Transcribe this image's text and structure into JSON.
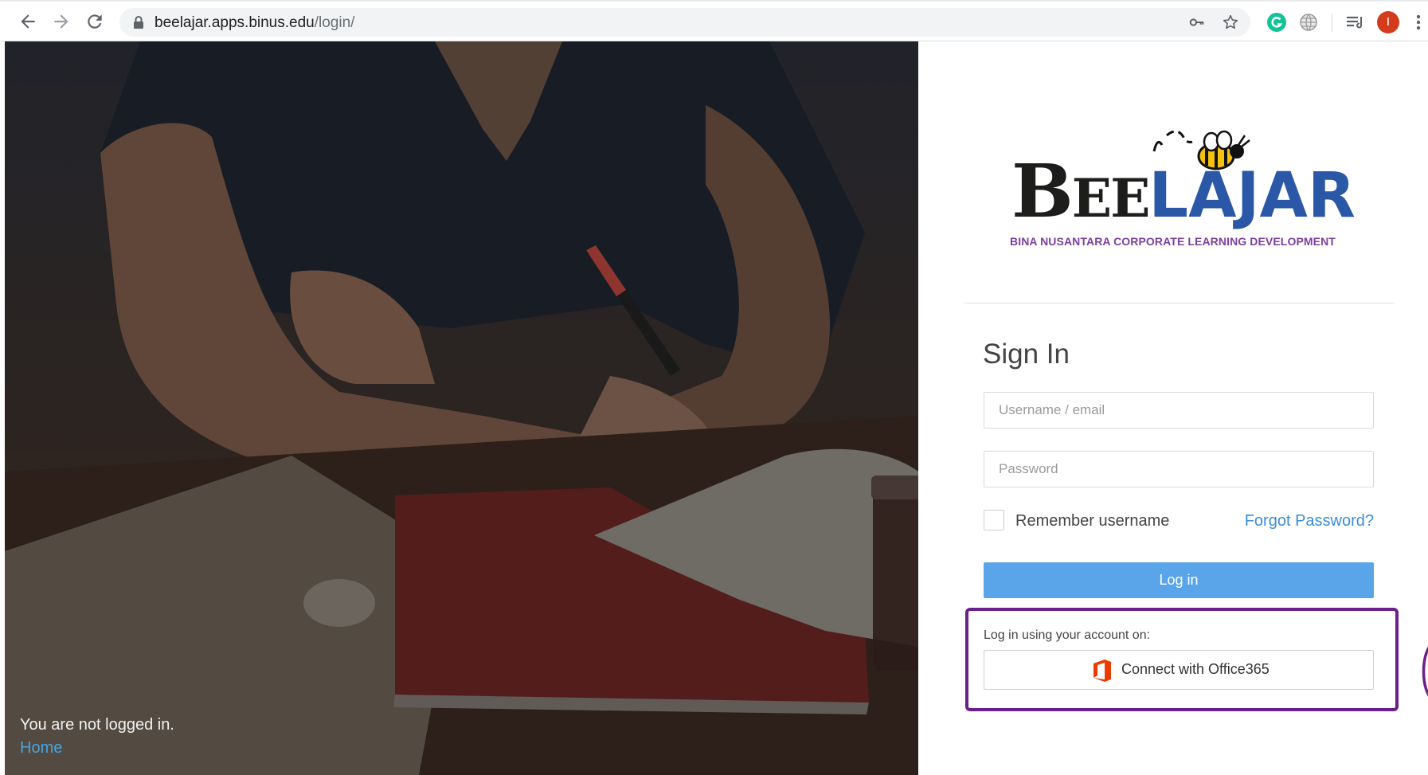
{
  "browser": {
    "url_host": "beelajar.apps.binus.edu",
    "url_path": "/login/",
    "profile_initial": "I",
    "icons": [
      "back-arrow-icon",
      "forward-arrow-icon",
      "reload-icon",
      "lock-icon",
      "key-icon",
      "star-icon",
      "grammarly-icon",
      "globe-icon",
      "reading-list-icon",
      "profile-avatar",
      "more-menu-icon"
    ]
  },
  "hero": {
    "status_text": "You are not logged in.",
    "home_link": "Home"
  },
  "logo": {
    "wordmark_black_big": "B",
    "wordmark_black_small": "EE",
    "wordmark_blue": "LAJAR",
    "tagline": "BINA NUSANTARA CORPORATE LEARNING DEVELOPMENT"
  },
  "login": {
    "title": "Sign In",
    "username_placeholder": "Username / email",
    "password_placeholder": "Password",
    "remember_label": "Remember username",
    "forgot_link": "Forgot Password?",
    "login_button": "Log in",
    "sso_label": "Log in using your account on:",
    "office_button": "Connect with Office365"
  },
  "colors": {
    "login_button": "#5aa5ea",
    "link": "#3c8ddc",
    "highlight_box": "#6a1f8a",
    "logo_blue": "#2a58a6",
    "logo_purple": "#7b3fa0",
    "office_orange": "#eb3c00"
  }
}
